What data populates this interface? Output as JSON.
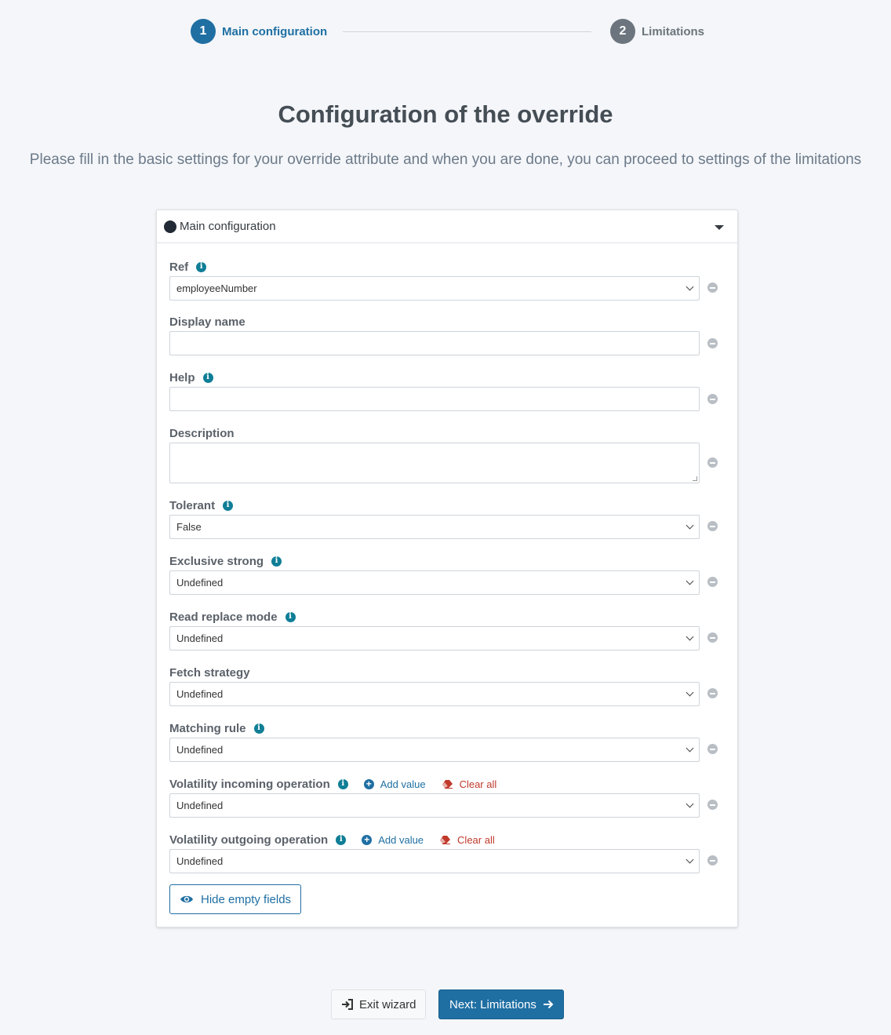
{
  "steps": [
    {
      "number": "1",
      "label": "Main configuration",
      "active": true
    },
    {
      "number": "2",
      "label": "Limitations",
      "active": false
    }
  ],
  "page": {
    "title": "Configuration of the override",
    "subtitle": "Please fill in the basic settings for your override attribute and when you are done, you can proceed to settings of the limitations"
  },
  "card": {
    "title": "Main configuration",
    "fields": {
      "ref": {
        "label": "Ref",
        "value": "employeeNumber"
      },
      "display_name": {
        "label": "Display name",
        "value": ""
      },
      "help": {
        "label": "Help",
        "value": ""
      },
      "description": {
        "label": "Description",
        "value": ""
      },
      "tolerant": {
        "label": "Tolerant",
        "value": "False"
      },
      "exclusive_strong": {
        "label": "Exclusive strong",
        "value": "Undefined"
      },
      "read_replace_mode": {
        "label": "Read replace mode",
        "value": "Undefined"
      },
      "fetch_strategy": {
        "label": "Fetch strategy",
        "value": "Undefined"
      },
      "matching_rule": {
        "label": "Matching rule",
        "value": "Undefined"
      },
      "volatility_incoming": {
        "label": "Volatility incoming operation",
        "value": "Undefined"
      },
      "volatility_outgoing": {
        "label": "Volatility outgoing operation",
        "value": "Undefined"
      }
    },
    "add_value_label": "Add value",
    "clear_all_label": "Clear all",
    "hide_empty_label": "Hide empty fields"
  },
  "footer": {
    "exit_label": "Exit wizard",
    "next_label": "Next: Limitations"
  },
  "colors": {
    "primary": "#1f6fa3",
    "info": "#0f7e96",
    "danger": "#c0392b",
    "background": "#f4f6f9"
  }
}
